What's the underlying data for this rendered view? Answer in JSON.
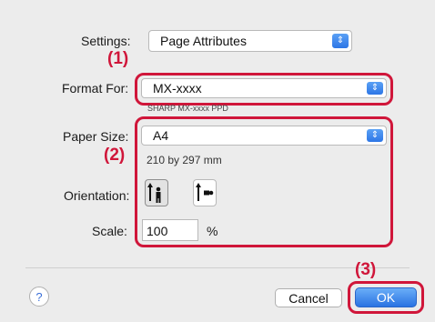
{
  "settings": {
    "label": "Settings:",
    "value": "Page Attributes"
  },
  "format_for": {
    "label": "Format For:",
    "value": "MX-xxxx",
    "subtext": "SHARP MX-xxxx PPD"
  },
  "paper_size": {
    "label": "Paper Size:",
    "value": "A4",
    "dimensions": "210 by 297 mm"
  },
  "orientation": {
    "label": "Orientation:",
    "selected": "portrait"
  },
  "scale": {
    "label": "Scale:",
    "value": "100",
    "unit": "%"
  },
  "callouts": {
    "one": "(1)",
    "two": "(2)",
    "three": "(3)"
  },
  "buttons": {
    "help": "?",
    "cancel": "Cancel",
    "ok": "OK"
  },
  "colors": {
    "highlight": "#d0163a",
    "accent": "#2d76e6"
  }
}
